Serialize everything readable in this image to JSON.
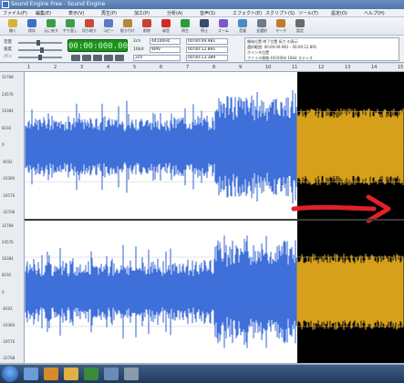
{
  "window": {
    "title": "Sound Engine Free - Sound Engine",
    "colors": {
      "waveform": "#3f6fd8",
      "selected_waveform": "#d6a01a",
      "selection_bg": "#000000",
      "arrow": "#e0202a",
      "time_display": "#1f8f1f"
    }
  },
  "menu": [
    "ファイル(F)",
    "編集(E)",
    "表示(V)",
    "再生(P)",
    "加工(P)",
    "分析(A)",
    "音声(S)",
    "エフェクト(E)",
    "スクリプト(S)",
    "ツール(T)",
    "設定(O)",
    "ヘルプ(H)"
  ],
  "toolbar": {
    "buttons": [
      {
        "label": "開く",
        "icon": "folder-icon",
        "color": "#d8b23a"
      },
      {
        "label": "保存",
        "icon": "save-icon",
        "color": "#3c6fc4"
      },
      {
        "label": "元に戻す",
        "icon": "undo-icon",
        "color": "#3c9c4a"
      },
      {
        "label": "やり直し",
        "icon": "redo-icon",
        "color": "#3c9c4a"
      },
      {
        "label": "切り取り",
        "icon": "cut-icon",
        "color": "#c84a3a"
      },
      {
        "label": "コピー",
        "icon": "copy-icon",
        "color": "#5a7ac4"
      },
      {
        "label": "貼り付け",
        "icon": "paste-icon",
        "color": "#b08a3a"
      },
      {
        "label": "削除",
        "icon": "delete-icon",
        "color": "#c8402e"
      },
      {
        "label": "録音",
        "icon": "record-icon",
        "color": "#d02a2a"
      },
      {
        "label": "再生",
        "icon": "play-icon",
        "color": "#2a9c3a"
      },
      {
        "label": "停止",
        "icon": "stop-icon",
        "color": "#3a4a6a"
      },
      {
        "label": "ズーム",
        "icon": "zoom-icon",
        "color": "#7a5ac4"
      },
      {
        "label": "音量",
        "icon": "volume-icon",
        "color": "#4a8ac4"
      },
      {
        "label": "全選択",
        "icon": "select-all-icon",
        "color": "#6a7a8a"
      },
      {
        "label": "マーク",
        "icon": "marker-icon",
        "color": "#c47a2a"
      },
      {
        "label": "設定",
        "icon": "settings-icon",
        "color": "#6a6a6a"
      }
    ]
  },
  "controls": {
    "time": "00:00:000.000",
    "volume_label": "音量",
    "speed_label": "速度",
    "pan_label": "パン",
    "channel_label": "2ch",
    "rate_label": "44100Hz",
    "bits_label": "16bit",
    "format_value": "WAV",
    "sel_start": "00:00:09.981",
    "sel_end": "00:00:12.891",
    "sel_len": "00:00:13.389",
    "info_lines": [
      "開始位置 終了位置 長さ の表示",
      "選択範囲: 00:00:09.981 - 00:00:12.891",
      "ポインタ位置",
      "ファイル情報 44100Hz 16bit ステレオ"
    ]
  },
  "ruler": {
    "ticks": [
      "1",
      "2",
      "3",
      "4",
      "5",
      "6",
      "7",
      "8",
      "9",
      "10",
      "11",
      "12",
      "13",
      "14",
      "15"
    ]
  },
  "amp_axis": {
    "labels": [
      "32768",
      "24576",
      "16384",
      "8192",
      "0",
      "-8192",
      "-16384",
      "-24576",
      "-32768"
    ]
  },
  "taskbar": {
    "icons": [
      "explorer-icon",
      "media-player-icon",
      "folder-icon",
      "sound-engine-icon",
      "app-icon",
      "app2-icon"
    ]
  }
}
